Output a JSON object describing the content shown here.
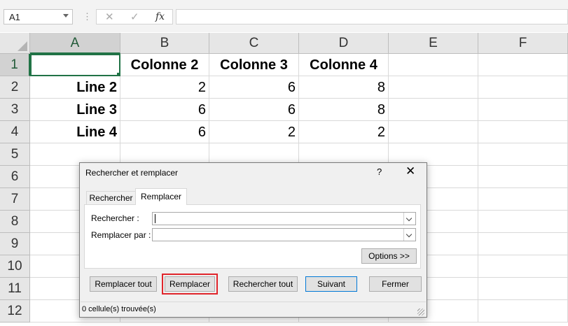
{
  "formula_bar": {
    "name_box": "A1",
    "cancel_glyph": "✕",
    "enter_glyph": "✓",
    "fx_label": "fx",
    "formula_value": ""
  },
  "columns": [
    "A",
    "B",
    "C",
    "D",
    "E",
    "F"
  ],
  "rows": [
    "1",
    "2",
    "3",
    "4",
    "5",
    "6",
    "7",
    "8",
    "9",
    "10",
    "11",
    "12"
  ],
  "cells": {
    "B1": "Colonne 2",
    "C1": "Colonne 3",
    "D1": "Colonne 4",
    "A2": "Line 2",
    "B2": "2",
    "C2": "6",
    "D2": "8",
    "A3": "Line 3",
    "B3": "6",
    "C3": "6",
    "D3": "8",
    "A4": "Line 4",
    "B4": "6",
    "C4": "2",
    "D4": "2"
  },
  "active_cell": "A1",
  "dialog": {
    "title": "Rechercher et remplacer",
    "help": "?",
    "close": "✕",
    "tabs": [
      "Rechercher",
      "Remplacer"
    ],
    "active_tab": "Remplacer",
    "find_label": "Rechercher :",
    "find_value": "",
    "replace_label": "Remplacer par :",
    "replace_value": "",
    "options_button": "Options >>",
    "buttons": {
      "replace_all": "Remplacer tout",
      "replace": "Remplacer",
      "find_all": "Rechercher tout",
      "find_next": "Suivant",
      "close": "Fermer"
    },
    "status": "0 cellule(s) trouvée(s)"
  },
  "colors": {
    "accent": "#217346",
    "highlight": "#e0252b",
    "focus": "#0078d7"
  }
}
